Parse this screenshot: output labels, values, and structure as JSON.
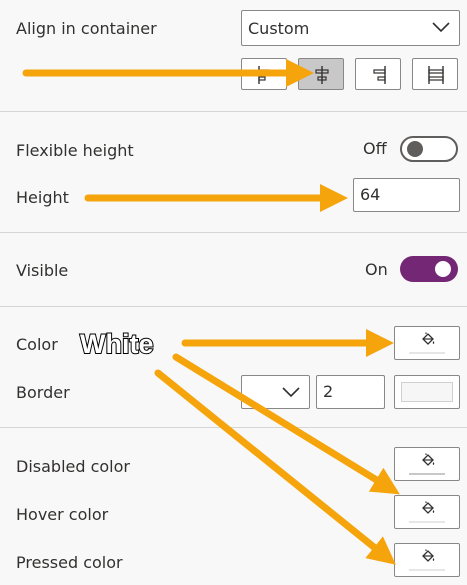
{
  "align_in_container": {
    "label": "Align in container",
    "value": "Custom",
    "options_icons": [
      "align-left-icon",
      "align-center-icon",
      "align-right-icon",
      "align-stretch-icon"
    ],
    "selected": "align-center-icon"
  },
  "flexible_height": {
    "label": "Flexible height",
    "state_text": "Off",
    "on": false
  },
  "height": {
    "label": "Height",
    "value": "64"
  },
  "visible": {
    "label": "Visible",
    "state_text": "On",
    "on": true
  },
  "color": {
    "label": "Color"
  },
  "border": {
    "label": "Border",
    "width_value": "2"
  },
  "disabled_color": {
    "label": "Disabled color"
  },
  "hover_color": {
    "label": "Hover color"
  },
  "pressed_color": {
    "label": "Pressed color"
  },
  "annotation": {
    "text": "White",
    "arrow_color": "#F5A40C"
  },
  "colors": {
    "toggle_on": "#742774",
    "panel_bg": "#F8F8F8",
    "border": "#8A8886"
  }
}
